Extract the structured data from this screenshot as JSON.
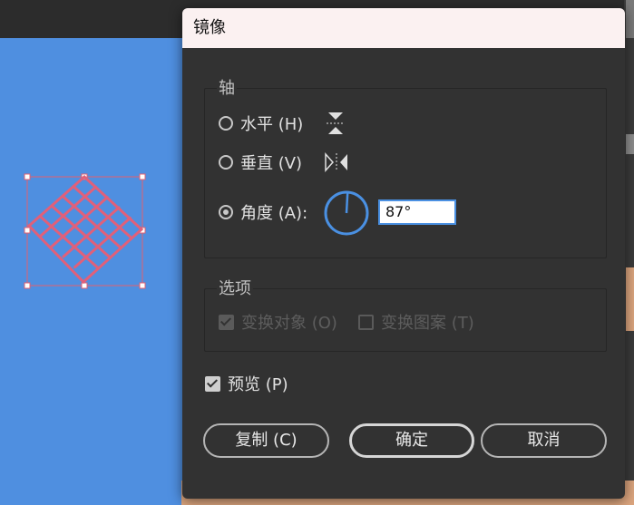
{
  "dialog": {
    "title": "镜像",
    "axis_group": {
      "label": "轴",
      "horizontal_label": "水平 (H)",
      "vertical_label": "垂直 (V)",
      "angle_label": "角度 (A):",
      "angle_value": "87°",
      "selected": "angle"
    },
    "options_group": {
      "label": "选项",
      "transform_objects_label": "变换对象 (O)",
      "transform_patterns_label": "变换图案 (T)"
    },
    "preview_label": "预览 (P)",
    "buttons": {
      "copy": "复制 (C)",
      "ok": "确定",
      "cancel": "取消"
    }
  },
  "icons": {
    "horizontal_axis": "flip-horizontal-axis-icon",
    "vertical_axis": "flip-vertical-axis-icon",
    "angle_dial": "angle-dial-icon"
  },
  "colors": {
    "dialog_bg": "#323232",
    "titlebar_bg": "#fbf1f1",
    "canvas_bg": "#4f8fe0",
    "accent": "#4a90e2",
    "selection": "#e06070"
  }
}
